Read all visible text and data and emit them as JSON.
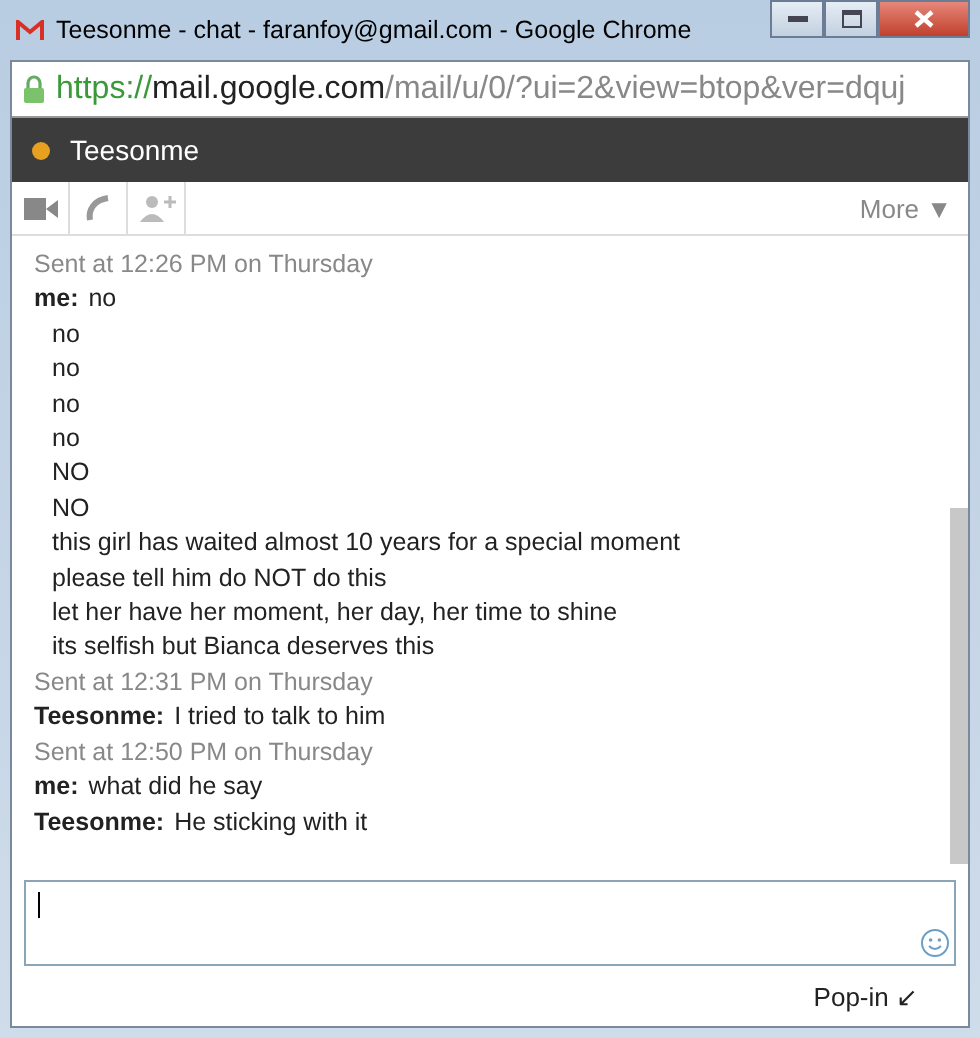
{
  "window": {
    "title": "Teesonme - chat - faranfoy@gmail.com - Google Chrome"
  },
  "address_bar": {
    "scheme": "https://",
    "host": "mail.google.com",
    "path": "/mail/u/0/?ui=2&view=btop&ver=dquj"
  },
  "contact": {
    "name": "Teesonme",
    "idle": true
  },
  "toolbar": {
    "more": "More ▼"
  },
  "messages": [
    {
      "kind": "timestamp",
      "text": "Sent at 12:26 PM on Thursday"
    },
    {
      "kind": "message",
      "sender": "me:",
      "text": "no"
    },
    {
      "kind": "line",
      "text": "no"
    },
    {
      "kind": "line",
      "text": "no"
    },
    {
      "kind": "line",
      "text": "no"
    },
    {
      "kind": "line",
      "text": "no"
    },
    {
      "kind": "line",
      "text": "NO"
    },
    {
      "kind": "line",
      "text": "NO"
    },
    {
      "kind": "line",
      "text": "this girl has waited almost 10 years for a special moment"
    },
    {
      "kind": "line",
      "text": "please tell him do NOT do this"
    },
    {
      "kind": "line",
      "text": "let her have her moment, her day, her time to shine"
    },
    {
      "kind": "line",
      "text": "its selfish but Bianca deserves this"
    },
    {
      "kind": "timestamp",
      "text": "Sent at 12:31 PM on Thursday"
    },
    {
      "kind": "message",
      "sender": "Teesonme:",
      "text": "I tried to talk to him"
    },
    {
      "kind": "timestamp",
      "text": "Sent at 12:50 PM on Thursday"
    },
    {
      "kind": "message",
      "sender": "me:",
      "text": "what did he say"
    },
    {
      "kind": "message",
      "sender": "Teesonme:",
      "text": "He sticking with it"
    }
  ],
  "footer": {
    "pop_in": "Pop-in ↙"
  }
}
